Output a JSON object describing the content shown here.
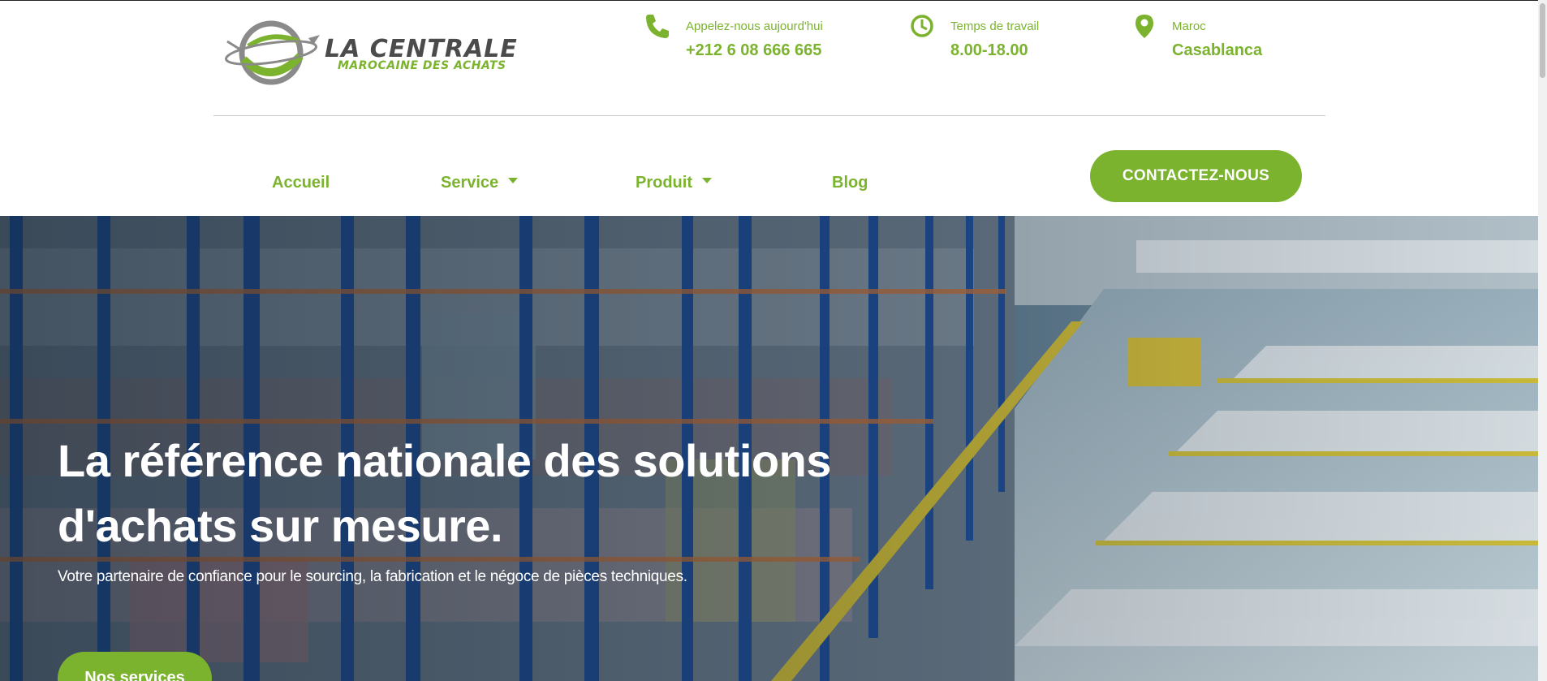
{
  "brand": {
    "name": "LA CENTRALE",
    "tagline": "MAROCAINE DES ACHATS",
    "colors": {
      "accent": "#7bb32e",
      "logo_dark": "#4b4b4b"
    }
  },
  "contact_info": [
    {
      "icon": "phone-icon",
      "label": "Appelez-nous aujourd'hui",
      "value": "+212 6 08 666 665"
    },
    {
      "icon": "clock-icon",
      "label": "Temps de travail",
      "value": "8.00-18.00"
    },
    {
      "icon": "location-pin-icon",
      "label": "Maroc",
      "value": "Casablanca"
    }
  ],
  "nav": {
    "items": [
      {
        "label": "Accueil",
        "has_dropdown": false
      },
      {
        "label": "Service",
        "has_dropdown": true
      },
      {
        "label": "Produit",
        "has_dropdown": true
      },
      {
        "label": "Blog",
        "has_dropdown": false
      }
    ],
    "cta_label": "CONTACTEZ-NOUS"
  },
  "hero": {
    "title_line1": "La référence nationale des solutions",
    "title_line2": "d'achats sur mesure.",
    "subtitle": "Votre partenaire de confiance pour le sourcing, la fabrication et le négoce de pièces techniques.",
    "button_label": "Nos services",
    "background": "warehouse-photo"
  }
}
